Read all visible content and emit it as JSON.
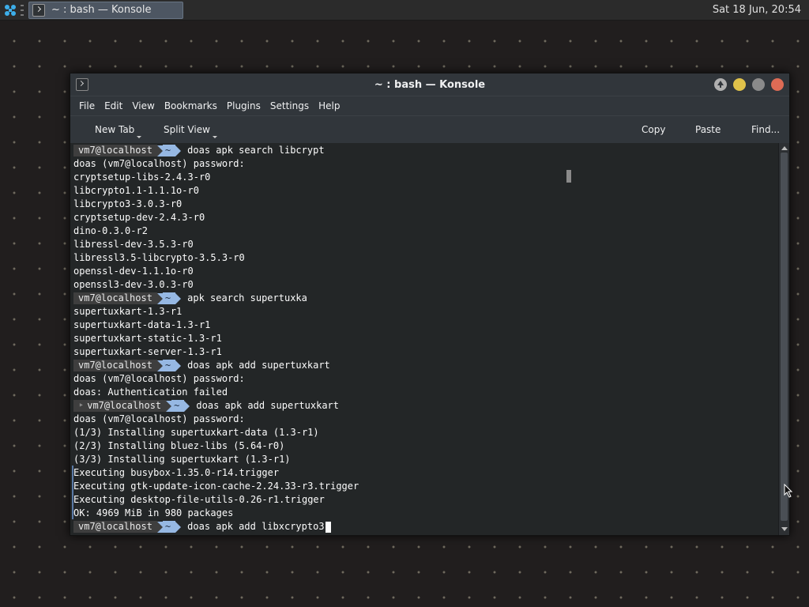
{
  "taskbar": {
    "task_label": "~ : bash — Konsole",
    "clock": "Sat 18 Jun, 20:54"
  },
  "window": {
    "title": "~ : bash — Konsole",
    "menu": [
      "File",
      "Edit",
      "View",
      "Bookmarks",
      "Plugins",
      "Settings",
      "Help"
    ],
    "toolbar": {
      "new_tab": "New Tab",
      "split_view": "Split View",
      "copy": "Copy",
      "paste": "Paste",
      "find": "Find..."
    }
  },
  "prompt": {
    "host": "vm7@localhost",
    "dir": "~"
  },
  "terminal": {
    "lines": [
      {
        "type": "prompt",
        "text": "doas apk search libcrypt"
      },
      {
        "type": "output",
        "text": "doas (vm7@localhost) password:"
      },
      {
        "type": "output",
        "text": "cryptsetup-libs-2.4.3-r0"
      },
      {
        "type": "output",
        "text": "libcrypto1.1-1.1.1o-r0"
      },
      {
        "type": "output",
        "text": "libcrypto3-3.0.3-r0"
      },
      {
        "type": "output",
        "text": "cryptsetup-dev-2.4.3-r0"
      },
      {
        "type": "output",
        "text": "dino-0.3.0-r2"
      },
      {
        "type": "output",
        "text": "libressl-dev-3.5.3-r0"
      },
      {
        "type": "output",
        "text": "libressl3.5-libcrypto-3.5.3-r0"
      },
      {
        "type": "output",
        "text": "openssl-dev-1.1.1o-r0"
      },
      {
        "type": "output",
        "text": "openssl3-dev-3.0.3-r0"
      },
      {
        "type": "prompt",
        "text": "apk search supertuxka"
      },
      {
        "type": "output",
        "text": "supertuxkart-1.3-r1"
      },
      {
        "type": "output",
        "text": "supertuxkart-data-1.3-r1"
      },
      {
        "type": "output",
        "text": "supertuxkart-static-1.3-r1"
      },
      {
        "type": "output",
        "text": "supertuxkart-server-1.3-r1"
      },
      {
        "type": "prompt",
        "text": "doas apk add supertuxkart"
      },
      {
        "type": "output",
        "text": "doas (vm7@localhost) password:"
      },
      {
        "type": "output",
        "text": "doas: Authentication failed"
      },
      {
        "type": "prompt-lock",
        "text": "doas apk add supertuxkart"
      },
      {
        "type": "output",
        "text": "doas (vm7@localhost) password:"
      },
      {
        "type": "output",
        "text": "(1/3) Installing supertuxkart-data (1.3-r1)"
      },
      {
        "type": "output",
        "text": "(2/3) Installing bluez-libs (5.64-r0)"
      },
      {
        "type": "output",
        "text": "(3/3) Installing supertuxkart (1.3-r1)"
      },
      {
        "type": "output",
        "text": "Executing busybox-1.35.0-r14.trigger"
      },
      {
        "type": "output",
        "text": "Executing gtk-update-icon-cache-2.24.33-r3.trigger"
      },
      {
        "type": "output",
        "text": "Executing desktop-file-utils-0.26-r1.trigger"
      },
      {
        "type": "output",
        "text": "OK: 4969 MiB in 980 packages"
      },
      {
        "type": "prompt-current",
        "text": "doas apk add libxcrypto3"
      }
    ]
  }
}
